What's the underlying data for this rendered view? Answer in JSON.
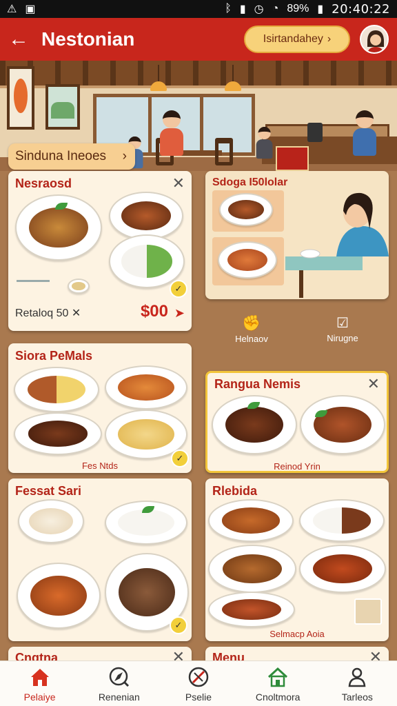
{
  "status_bar": {
    "time": "20:40:22",
    "battery": "89%"
  },
  "header": {
    "back_icon": "arrow-left-icon",
    "title": "Nestonian",
    "search_label": "Isirtandahey",
    "search_icon": "chevron-down-icon"
  },
  "banner": {
    "explore_label": "Sinduna Ineoes",
    "explore_icon": "chevron-right-icon"
  },
  "cards": {
    "c1": {
      "title": "Nesraosd",
      "footer_label": "Retaloq 50",
      "price": "$00"
    },
    "c2": {
      "title": "Sdoga I50lolar",
      "action1": "Helnaov",
      "action2": "Nirugne"
    },
    "c3": {
      "title": "Siora PeMals",
      "caption": "Fes Ntds"
    },
    "c4": {
      "title": "Rangua Nemis",
      "caption": "Reinod Yrin"
    },
    "c5": {
      "title": "Fessat Sari"
    },
    "c6": {
      "title": "Rlebida",
      "caption": "Selmacp Aoia"
    },
    "c7": {
      "title": "Cngtna"
    },
    "c8": {
      "title": "Menu"
    }
  },
  "nav": [
    {
      "label": "Pelaiye",
      "icon": "home-icon"
    },
    {
      "label": "Renenian",
      "icon": "compass-icon"
    },
    {
      "label": "Pselie",
      "icon": "no-entry-icon"
    },
    {
      "label": "Cnoltmora",
      "icon": "house-outline-icon"
    },
    {
      "label": "Tarleos",
      "icon": "profile-icon"
    }
  ],
  "colors": {
    "primary_red": "#c8261c",
    "accent_yellow": "#f7d27a",
    "card_bg": "#fdf3e2",
    "price_red": "#c8261c"
  }
}
